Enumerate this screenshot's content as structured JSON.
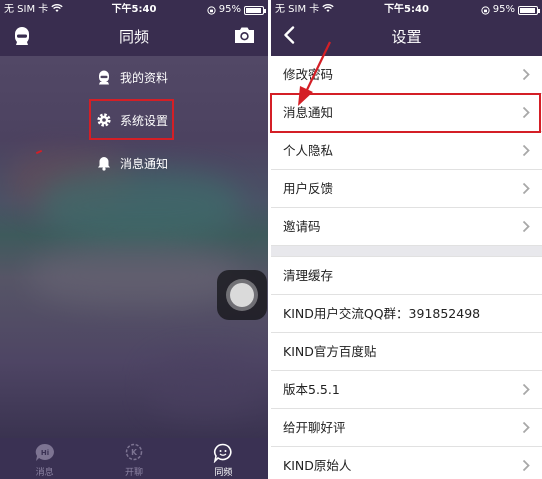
{
  "status_bar": {
    "carrier": "无 SIM 卡",
    "time": "下午5:40",
    "battery": "95%",
    "battery_level": 0.95
  },
  "left_screen": {
    "title": "同频",
    "header_icons": [
      "avatar-icon",
      "camera-icon"
    ],
    "menu": [
      {
        "label": "我的资料",
        "icon": "person-icon"
      },
      {
        "label": "系统设置",
        "icon": "gear-icon",
        "highlighted": true
      },
      {
        "label": "消息通知",
        "icon": "bell-icon"
      }
    ],
    "tabs": [
      {
        "label": "消息",
        "icon": "chat-hi-icon",
        "active": false
      },
      {
        "label": "开聊",
        "icon": "chat-k-icon",
        "active": false
      },
      {
        "label": "同频",
        "icon": "chat-face-icon",
        "active": true
      }
    ],
    "colors": {
      "header": "#392d4f",
      "highlight": "#d41f26"
    }
  },
  "right_screen": {
    "title": "设置",
    "back_icon": "chevron-left-icon",
    "group1": [
      {
        "label": "修改密码",
        "chevron": true
      },
      {
        "label": "消息通知",
        "chevron": true,
        "highlighted": true
      },
      {
        "label": "个人隐私",
        "chevron": true
      },
      {
        "label": "用户反馈",
        "chevron": true
      },
      {
        "label": "邀请码",
        "chevron": true
      }
    ],
    "group2": [
      {
        "label": "清理缓存",
        "chevron": false
      },
      {
        "label": "KIND用户交流QQ群：391852498",
        "chevron": false
      },
      {
        "label": "KIND官方百度贴",
        "chevron": false
      },
      {
        "label": "版本5.5.1",
        "chevron": true
      },
      {
        "label": "给开聊好评",
        "chevron": true
      },
      {
        "label": "KIND原始人",
        "chevron": true
      }
    ]
  }
}
